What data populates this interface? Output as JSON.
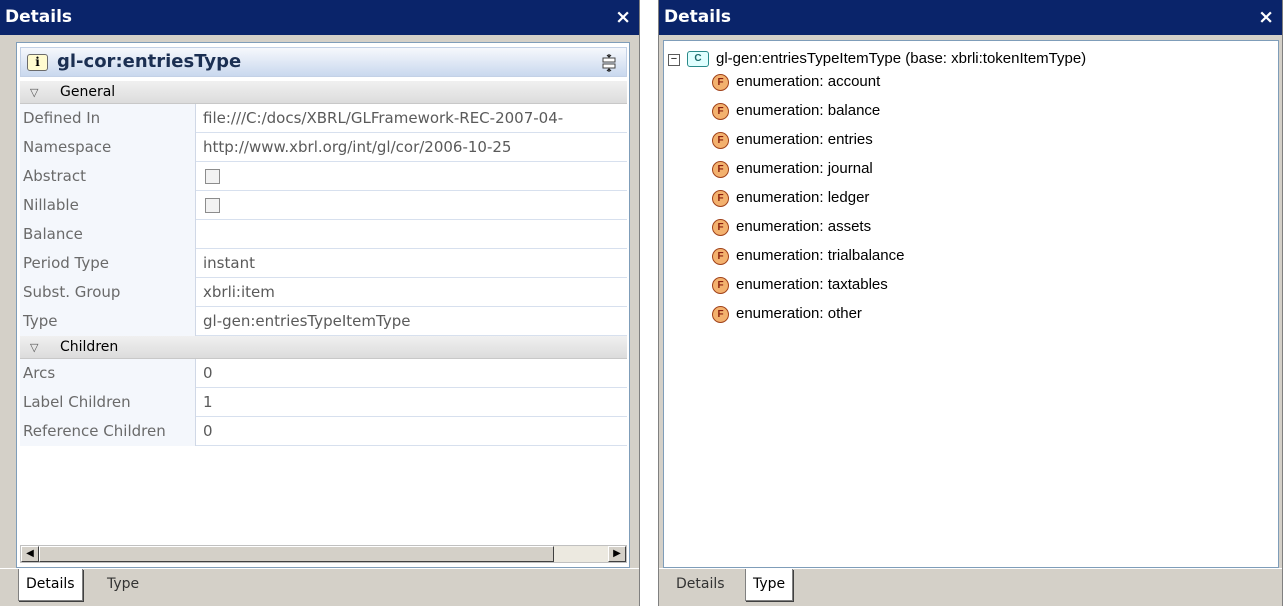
{
  "left_window": {
    "title": "Details",
    "close_glyph": "×",
    "header": {
      "icon_glyph": "i",
      "title": "gl-cor:entriesType"
    },
    "sections": {
      "general": {
        "label": "General",
        "rows": [
          {
            "name": "Defined In",
            "value": "file:///C:/docs/XBRL/GLFramework-REC-2007-04-"
          },
          {
            "name": "Namespace",
            "value": "http://www.xbrl.org/int/gl/cor/2006-10-25"
          },
          {
            "name": "Abstract",
            "value": ""
          },
          {
            "name": "Nillable",
            "value": ""
          },
          {
            "name": "Balance",
            "value": ""
          },
          {
            "name": "Period Type",
            "value": "instant"
          },
          {
            "name": "Subst. Group",
            "value": "xbrli:item"
          },
          {
            "name": "Type",
            "value": "gl-gen:entriesTypeItemType"
          }
        ]
      },
      "children": {
        "label": "Children",
        "rows": [
          {
            "name": "Arcs",
            "value": "0"
          },
          {
            "name": "Label Children",
            "value": "1"
          },
          {
            "name": "Reference Children",
            "value": "0"
          }
        ]
      }
    },
    "tabs": [
      "Details",
      "Type"
    ],
    "active_tab": "Details"
  },
  "right_window": {
    "title": "Details",
    "close_glyph": "×",
    "tree": {
      "expander_glyph": "−",
      "type_icon_glyph": "C",
      "root_label": "gl-gen:entriesTypeItemType (base: xbrli:tokenItemType)",
      "facet_icon_glyph": "F",
      "items": [
        "enumeration: account",
        "enumeration: balance",
        "enumeration: entries",
        "enumeration: journal",
        "enumeration: ledger",
        "enumeration: assets",
        "enumeration: trialbalance",
        "enumeration: taxtables",
        "enumeration: other"
      ]
    },
    "tabs": [
      "Details",
      "Type"
    ],
    "active_tab": "Type"
  },
  "colors": {
    "titlebar": "#0a246a",
    "chrome": "#d4d0c8",
    "header_gradient_bottom": "#c9d8ee",
    "facet_icon": "#f3b16e"
  }
}
